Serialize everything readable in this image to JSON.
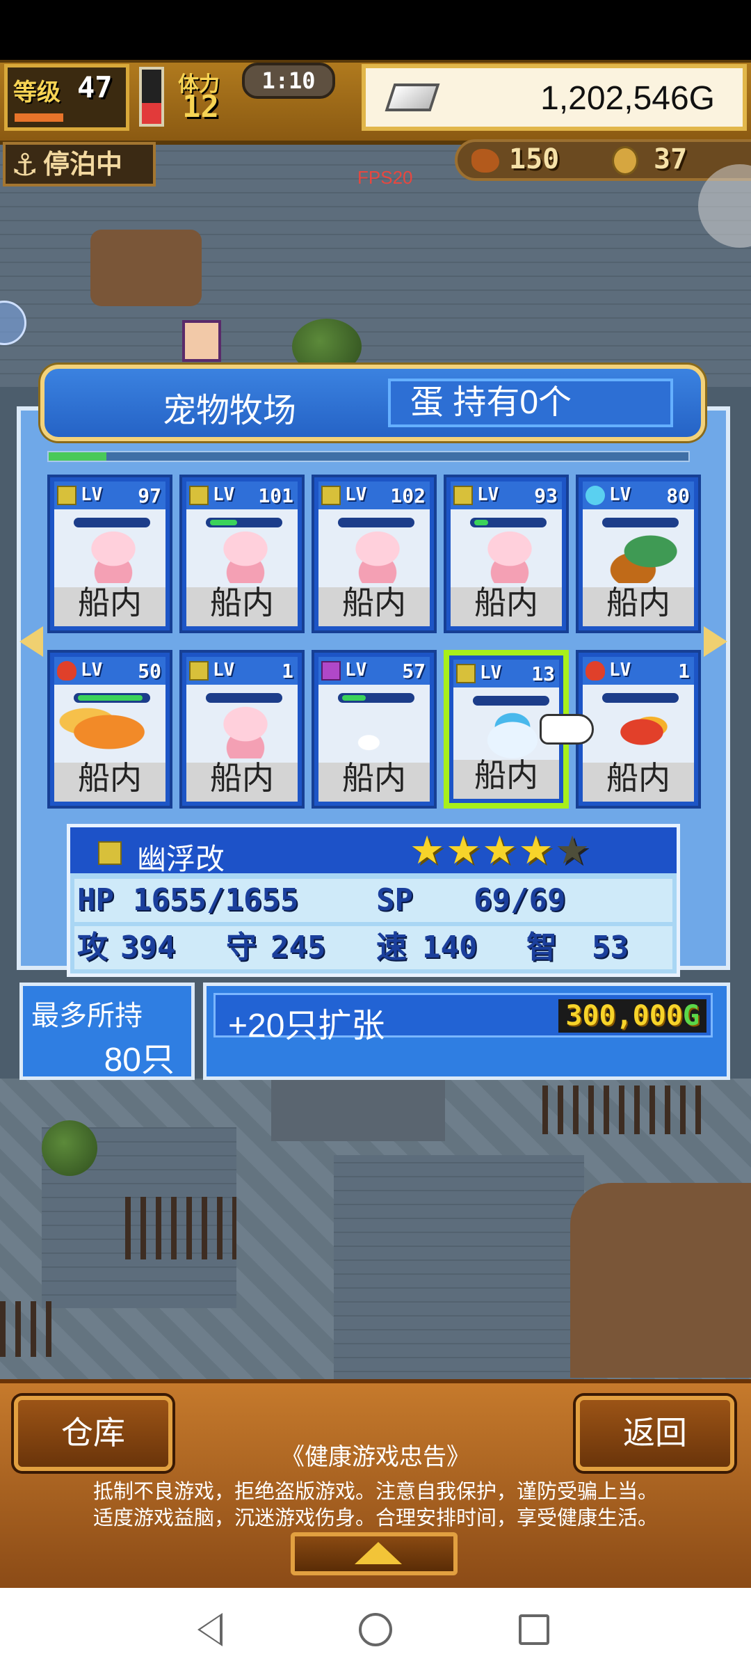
{
  "hud": {
    "level_label": "等级",
    "level": "47",
    "stamina_label": "体力",
    "stamina": "12",
    "stamina_fraction": 0.38,
    "timer": "1:10",
    "gold": "1,202,546G",
    "status": "停泊中",
    "food": "150",
    "coins": "37"
  },
  "debug": {
    "fps": "FPS20"
  },
  "ranch": {
    "title": "宠物牧场",
    "egg_info": "蛋 持有0个",
    "capacity_fraction": 0.09,
    "pets": [
      {
        "element": "thunder",
        "lv": "97",
        "hp_fraction": 0.0,
        "sprite": "axolotl",
        "location": "船内"
      },
      {
        "element": "thunder",
        "lv": "101",
        "hp_fraction": 0.4,
        "sprite": "axolotl",
        "location": "船内"
      },
      {
        "element": "thunder",
        "lv": "102",
        "hp_fraction": 0.0,
        "sprite": "axolotl",
        "location": "船内"
      },
      {
        "element": "thunder",
        "lv": "93",
        "hp_fraction": 0.2,
        "sprite": "axolotl",
        "location": "船内"
      },
      {
        "element": "water",
        "lv": "80",
        "hp_fraction": 0.0,
        "sprite": "hermit-crab",
        "location": "船内"
      },
      {
        "element": "fire",
        "lv": "50",
        "hp_fraction": 0.95,
        "sprite": "dragon",
        "location": "船内"
      },
      {
        "element": "thunder",
        "lv": "1",
        "hp_fraction": 0.0,
        "sprite": "axolotl",
        "location": "船内"
      },
      {
        "element": "dark",
        "lv": "57",
        "hp_fraction": 0.35,
        "sprite": "ghost",
        "location": "船内"
      },
      {
        "element": "thunder",
        "lv": "13",
        "hp_fraction": 0.0,
        "sprite": "ufo",
        "location": "船内",
        "selected": true
      },
      {
        "element": "fire",
        "lv": "1",
        "hp_fraction": 0.0,
        "sprite": "firebird",
        "location": "船内"
      }
    ],
    "lv_prefix": "LV",
    "selected": {
      "element": "thunder",
      "name": "幽浮改",
      "stars_filled": 4,
      "stars_total": 5,
      "hp_label": "HP",
      "hp": "1655/1655",
      "sp_label": "SP",
      "sp": "69/69",
      "atk_label": "攻",
      "atk": "394",
      "def_label": "守",
      "def": "245",
      "spd_label": "速",
      "spd": "140",
      "int_label": "智",
      "int": "53"
    },
    "max_hold_label": "最多所持",
    "max_hold_value": "80只",
    "expand_label": "+20只扩张",
    "expand_price": "300,000",
    "expand_currency": "G"
  },
  "bottom": {
    "warehouse": "仓库",
    "back": "返回",
    "notice_title": "《健康游戏忠告》",
    "notice_line1": "抵制不良游戏，拒绝盗版游戏。注意自我保护，谨防受骗上当。",
    "notice_line2": "适度游戏益脑，沉迷游戏伤身。合理安排时间，享受健康生活。"
  },
  "colors": {
    "panel_blue": "#2f7ee2",
    "hp_green": "#3bd35a",
    "selected_border": "#a8f01a",
    "star_gold": "#f7d42a"
  }
}
